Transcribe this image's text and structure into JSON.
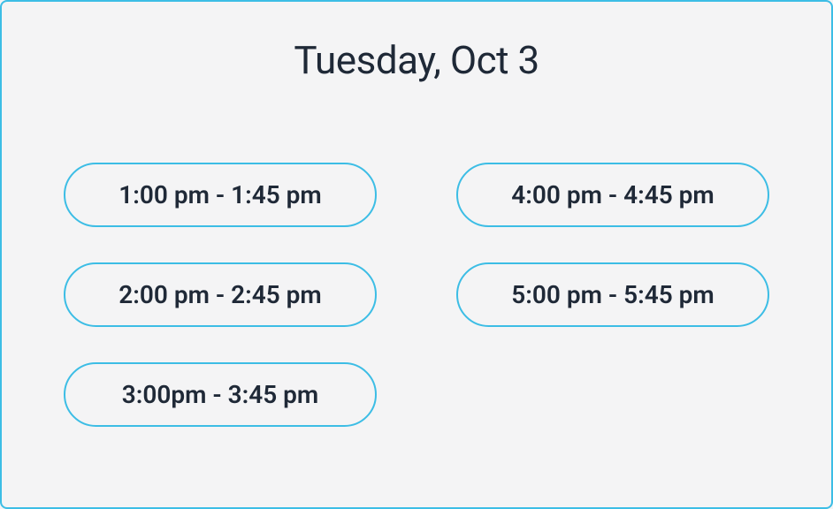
{
  "title": "Tuesday, Oct 3",
  "slots": [
    "1:00 pm - 1:45 pm",
    "4:00 pm - 4:45 pm",
    "2:00 pm - 2:45 pm",
    "5:00 pm - 5:45 pm",
    "3:00pm - 3:45 pm"
  ],
  "colors": {
    "border": "#3cbde5",
    "text": "#1f2937",
    "background": "#f4f4f5"
  }
}
